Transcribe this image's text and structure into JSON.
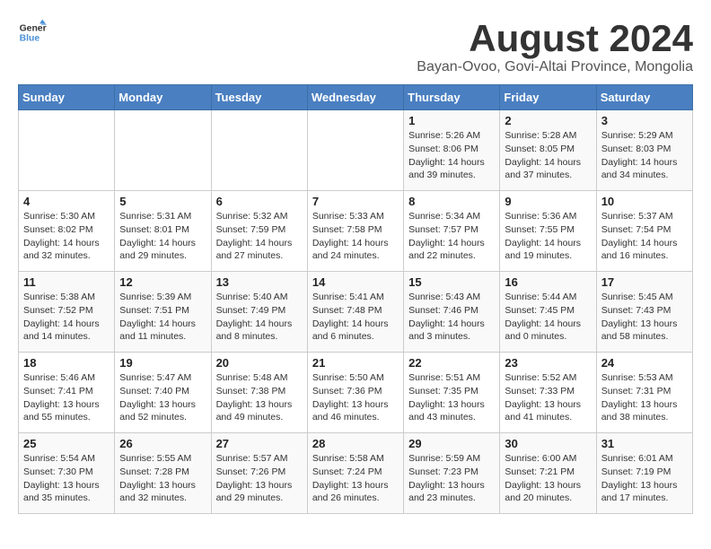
{
  "logo": {
    "general": "General",
    "blue": "Blue"
  },
  "title": "August 2024",
  "subtitle": "Bayan-Ovoo, Govi-Altai Province, Mongolia",
  "days_of_week": [
    "Sunday",
    "Monday",
    "Tuesday",
    "Wednesday",
    "Thursday",
    "Friday",
    "Saturday"
  ],
  "weeks": [
    [
      {
        "day": "",
        "info": ""
      },
      {
        "day": "",
        "info": ""
      },
      {
        "day": "",
        "info": ""
      },
      {
        "day": "",
        "info": ""
      },
      {
        "day": "1",
        "info": "Sunrise: 5:26 AM\nSunset: 8:06 PM\nDaylight: 14 hours\nand 39 minutes."
      },
      {
        "day": "2",
        "info": "Sunrise: 5:28 AM\nSunset: 8:05 PM\nDaylight: 14 hours\nand 37 minutes."
      },
      {
        "day": "3",
        "info": "Sunrise: 5:29 AM\nSunset: 8:03 PM\nDaylight: 14 hours\nand 34 minutes."
      }
    ],
    [
      {
        "day": "4",
        "info": "Sunrise: 5:30 AM\nSunset: 8:02 PM\nDaylight: 14 hours\nand 32 minutes."
      },
      {
        "day": "5",
        "info": "Sunrise: 5:31 AM\nSunset: 8:01 PM\nDaylight: 14 hours\nand 29 minutes."
      },
      {
        "day": "6",
        "info": "Sunrise: 5:32 AM\nSunset: 7:59 PM\nDaylight: 14 hours\nand 27 minutes."
      },
      {
        "day": "7",
        "info": "Sunrise: 5:33 AM\nSunset: 7:58 PM\nDaylight: 14 hours\nand 24 minutes."
      },
      {
        "day": "8",
        "info": "Sunrise: 5:34 AM\nSunset: 7:57 PM\nDaylight: 14 hours\nand 22 minutes."
      },
      {
        "day": "9",
        "info": "Sunrise: 5:36 AM\nSunset: 7:55 PM\nDaylight: 14 hours\nand 19 minutes."
      },
      {
        "day": "10",
        "info": "Sunrise: 5:37 AM\nSunset: 7:54 PM\nDaylight: 14 hours\nand 16 minutes."
      }
    ],
    [
      {
        "day": "11",
        "info": "Sunrise: 5:38 AM\nSunset: 7:52 PM\nDaylight: 14 hours\nand 14 minutes."
      },
      {
        "day": "12",
        "info": "Sunrise: 5:39 AM\nSunset: 7:51 PM\nDaylight: 14 hours\nand 11 minutes."
      },
      {
        "day": "13",
        "info": "Sunrise: 5:40 AM\nSunset: 7:49 PM\nDaylight: 14 hours\nand 8 minutes."
      },
      {
        "day": "14",
        "info": "Sunrise: 5:41 AM\nSunset: 7:48 PM\nDaylight: 14 hours\nand 6 minutes."
      },
      {
        "day": "15",
        "info": "Sunrise: 5:43 AM\nSunset: 7:46 PM\nDaylight: 14 hours\nand 3 minutes."
      },
      {
        "day": "16",
        "info": "Sunrise: 5:44 AM\nSunset: 7:45 PM\nDaylight: 14 hours\nand 0 minutes."
      },
      {
        "day": "17",
        "info": "Sunrise: 5:45 AM\nSunset: 7:43 PM\nDaylight: 13 hours\nand 58 minutes."
      }
    ],
    [
      {
        "day": "18",
        "info": "Sunrise: 5:46 AM\nSunset: 7:41 PM\nDaylight: 13 hours\nand 55 minutes."
      },
      {
        "day": "19",
        "info": "Sunrise: 5:47 AM\nSunset: 7:40 PM\nDaylight: 13 hours\nand 52 minutes."
      },
      {
        "day": "20",
        "info": "Sunrise: 5:48 AM\nSunset: 7:38 PM\nDaylight: 13 hours\nand 49 minutes."
      },
      {
        "day": "21",
        "info": "Sunrise: 5:50 AM\nSunset: 7:36 PM\nDaylight: 13 hours\nand 46 minutes."
      },
      {
        "day": "22",
        "info": "Sunrise: 5:51 AM\nSunset: 7:35 PM\nDaylight: 13 hours\nand 43 minutes."
      },
      {
        "day": "23",
        "info": "Sunrise: 5:52 AM\nSunset: 7:33 PM\nDaylight: 13 hours\nand 41 minutes."
      },
      {
        "day": "24",
        "info": "Sunrise: 5:53 AM\nSunset: 7:31 PM\nDaylight: 13 hours\nand 38 minutes."
      }
    ],
    [
      {
        "day": "25",
        "info": "Sunrise: 5:54 AM\nSunset: 7:30 PM\nDaylight: 13 hours\nand 35 minutes."
      },
      {
        "day": "26",
        "info": "Sunrise: 5:55 AM\nSunset: 7:28 PM\nDaylight: 13 hours\nand 32 minutes."
      },
      {
        "day": "27",
        "info": "Sunrise: 5:57 AM\nSunset: 7:26 PM\nDaylight: 13 hours\nand 29 minutes."
      },
      {
        "day": "28",
        "info": "Sunrise: 5:58 AM\nSunset: 7:24 PM\nDaylight: 13 hours\nand 26 minutes."
      },
      {
        "day": "29",
        "info": "Sunrise: 5:59 AM\nSunset: 7:23 PM\nDaylight: 13 hours\nand 23 minutes."
      },
      {
        "day": "30",
        "info": "Sunrise: 6:00 AM\nSunset: 7:21 PM\nDaylight: 13 hours\nand 20 minutes."
      },
      {
        "day": "31",
        "info": "Sunrise: 6:01 AM\nSunset: 7:19 PM\nDaylight: 13 hours\nand 17 minutes."
      }
    ]
  ]
}
